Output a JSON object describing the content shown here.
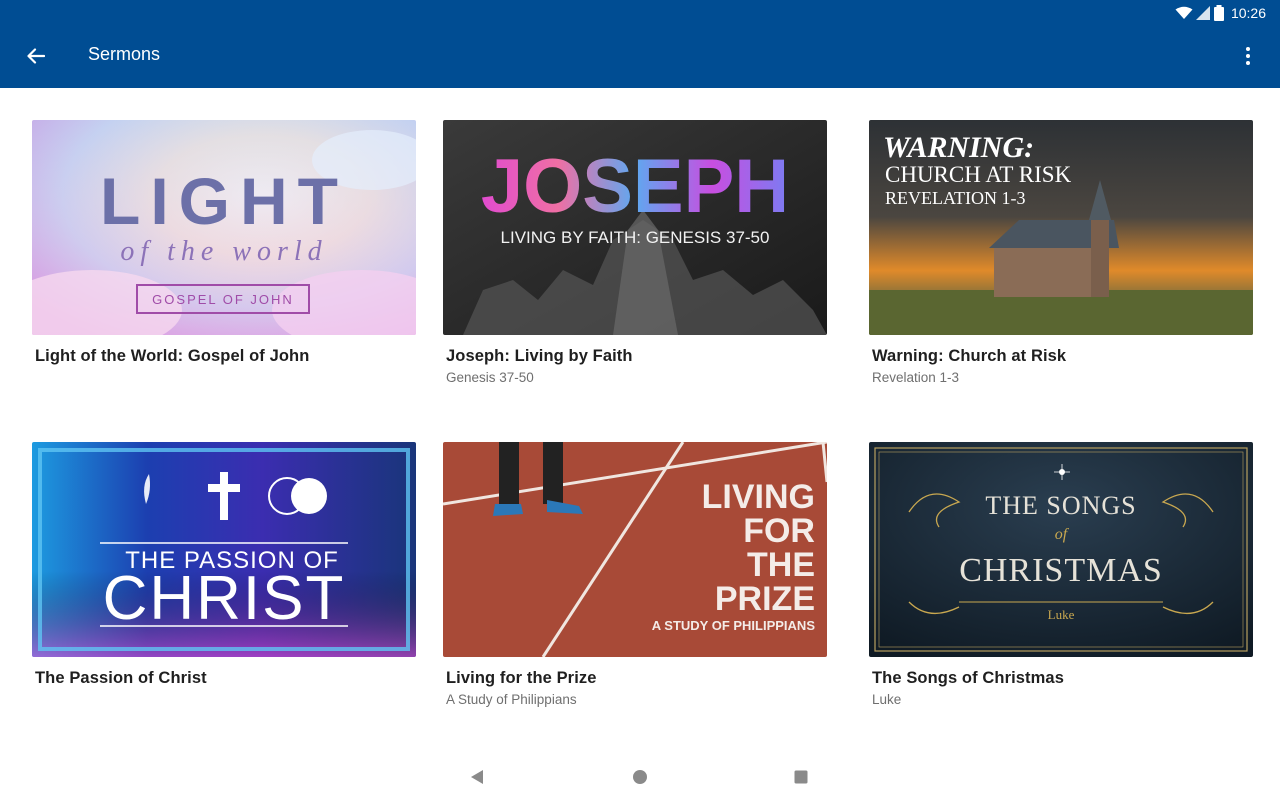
{
  "status": {
    "time": "10:26",
    "icons": [
      "wifi-icon",
      "signal-icon",
      "battery-icon"
    ]
  },
  "toolbar": {
    "title": "Sermons",
    "back_icon": "arrow-back-icon",
    "more_icon": "more-vert-icon"
  },
  "colors": {
    "appbar": "#004d93",
    "title_text": "#1f1f1f",
    "subtitle_text": "#6f6f6f"
  },
  "sermons": [
    {
      "title": "Light of the World: Gospel of John",
      "subtitle": "",
      "art": {
        "line1": "LIGHT",
        "line2": "of the world",
        "line3": "GOSPEL OF JOHN"
      }
    },
    {
      "title": "Joseph: Living by Faith",
      "subtitle": "Genesis 37-50",
      "art": {
        "line1": "JOSEPH",
        "line2": "LIVING BY FAITH: GENESIS 37-50"
      }
    },
    {
      "title": "Warning: Church at Risk",
      "subtitle": "Revelation 1-3",
      "art": {
        "line1": "WARNING:",
        "line2": "CHURCH AT RISK",
        "line3": "REVELATION 1-3"
      }
    },
    {
      "title": "The Passion of Christ",
      "subtitle": "",
      "art": {
        "line1": "THE PASSION OF",
        "line2": "CHRIST"
      }
    },
    {
      "title": "Living for the Prize",
      "subtitle": "A Study of Philippians",
      "art": {
        "line1": "LIVING",
        "line2": "FOR",
        "line3": "THE",
        "line4": "PRIZE",
        "line5": "A STUDY OF PHILIPPIANS"
      }
    },
    {
      "title": "The Songs of Christmas",
      "subtitle": "Luke",
      "art": {
        "line1": "THE SONGS",
        "line2": "of",
        "line3": "CHRISTMAS",
        "line4": "Luke"
      }
    }
  ],
  "navbar": {
    "icons": [
      "back-triangle-icon",
      "home-circle-icon",
      "recents-square-icon"
    ]
  }
}
